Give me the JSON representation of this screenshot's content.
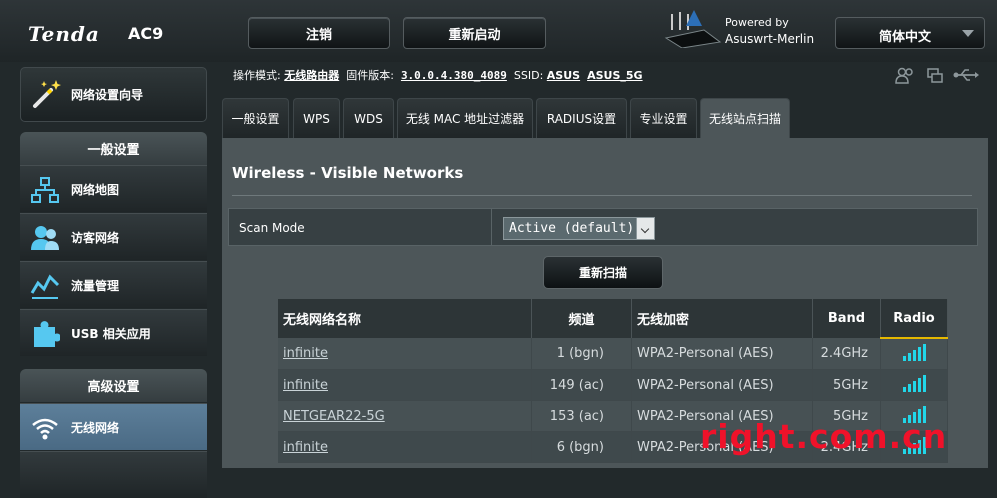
{
  "header": {
    "logo": "Tenda",
    "model": "AC9",
    "logout_label": "注销",
    "reboot_label": "重新启动",
    "powered_by": "Powered by",
    "firmware_brand": "Asuswrt-Merlin",
    "language": "简体中文"
  },
  "sidebar": {
    "wizard_label": "网络设置向导",
    "general_section": "一般设置",
    "general_items": [
      "网络地图",
      "访客网络",
      "流量管理",
      "USB 相关应用"
    ],
    "advanced_section": "高级设置",
    "advanced_items": [
      "无线网络"
    ]
  },
  "status": {
    "mode_label": "操作模式:",
    "mode_value": "无线路由器",
    "fw_label": "固件版本:",
    "fw_value": "3.0.0.4.380_4089",
    "ssid_label": "SSID:",
    "ssid_1": "ASUS",
    "ssid_2": "ASUS_5G"
  },
  "tabs": [
    "一般设置",
    "WPS",
    "WDS",
    "无线 MAC 地址过滤器",
    "RADIUS设置",
    "专业设置",
    "无线站点扫描"
  ],
  "active_tab": "无线站点扫描",
  "panel": {
    "title": "Wireless - Visible Networks",
    "scan_mode_label": "Scan Mode",
    "scan_mode_value": "Active (default)",
    "rescan_label": "重新扫描"
  },
  "table": {
    "headers": [
      "无线网络名称",
      "频道",
      "无线加密",
      "Band",
      "Radio"
    ],
    "rows": [
      {
        "ssid": "infinite",
        "channel": "1 (bgn)",
        "encryption": "WPA2-Personal (AES)",
        "band": "2.4GHz",
        "signal": 1.0
      },
      {
        "ssid": "infinite",
        "channel": "149 (ac)",
        "encryption": "WPA2-Personal (AES)",
        "band": "5GHz",
        "signal": 1.0
      },
      {
        "ssid": "NETGEAR22-5G",
        "channel": "153 (ac)",
        "encryption": "WPA2-Personal (AES)",
        "band": "5GHz",
        "signal": 1.0
      },
      {
        "ssid": "infinite",
        "channel": "6 (bgn)",
        "encryption": "WPA2-Personal (AES)",
        "band": "2.4GHz",
        "signal": 1.0
      }
    ]
  },
  "watermark": "right.com.cn",
  "colors": {
    "signal": "#21d7e9",
    "radio_header_accent": "#e5b800",
    "active_nav": "#5d7f9a",
    "watermark": "#f0122a"
  }
}
